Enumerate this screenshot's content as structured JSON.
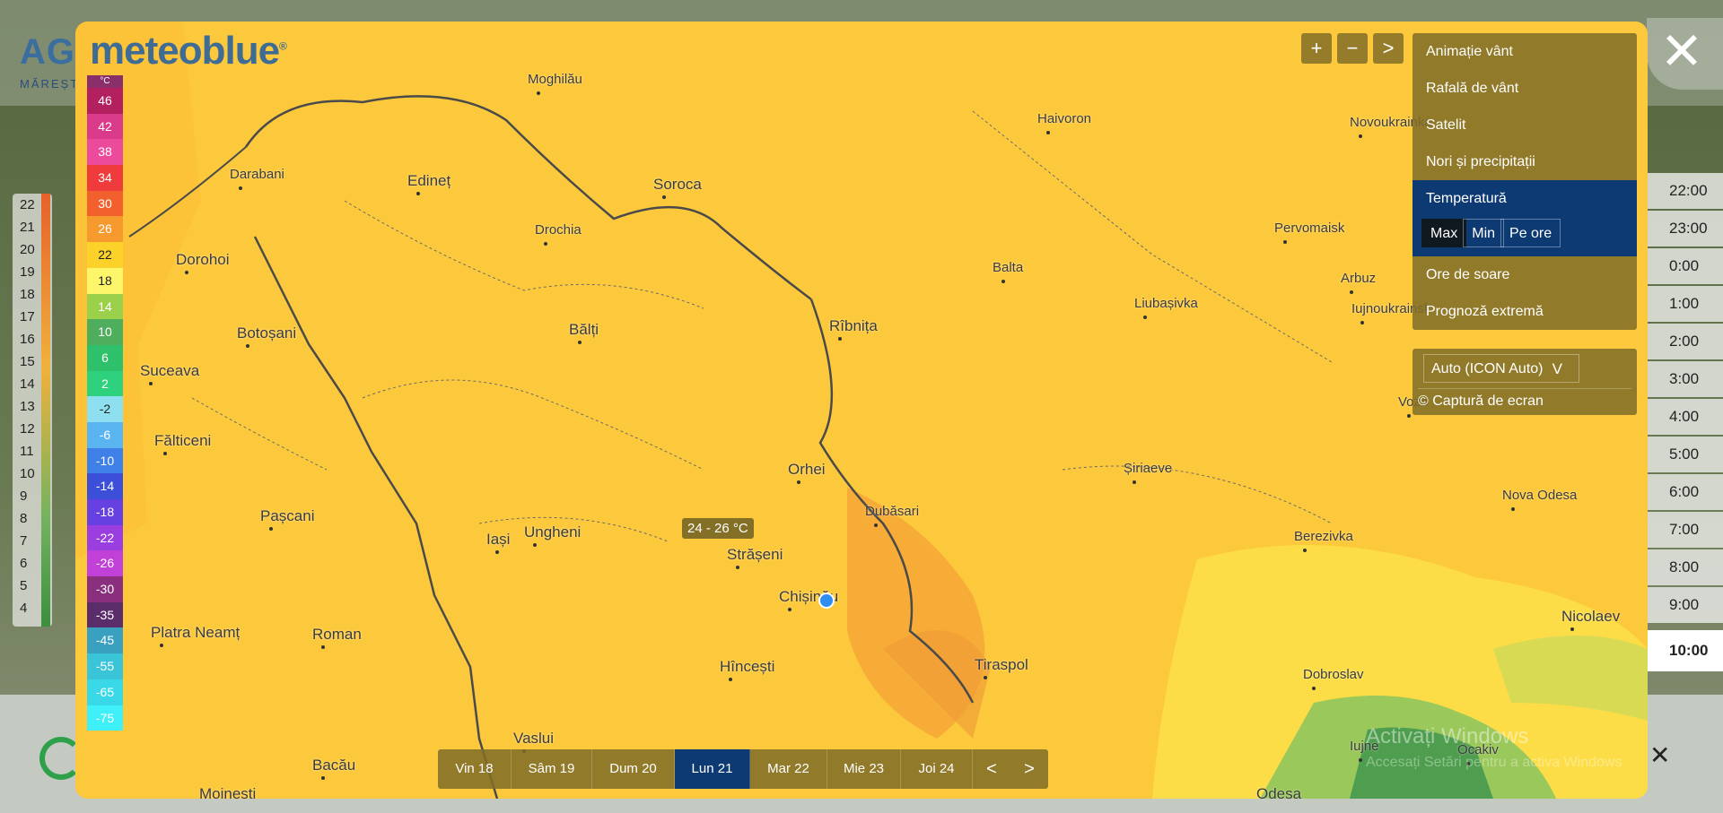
{
  "background": {
    "logo_text": "AGR",
    "logo_sub": "MĂREȘT",
    "scale_values": [
      "22",
      "21",
      "20",
      "19",
      "18",
      "17",
      "16",
      "15",
      "14",
      "13",
      "12",
      "11",
      "10",
      "9",
      "8",
      "7",
      "6",
      "5",
      "4"
    ],
    "hours": [
      "22:00",
      "23:00",
      "0:00",
      "1:00",
      "2:00",
      "3:00",
      "4:00",
      "5:00",
      "6:00",
      "7:00",
      "8:00",
      "9:00",
      "10:00"
    ],
    "selected_hour": "10:00",
    "close_big": "✕",
    "close_small": "✕"
  },
  "modal": {
    "brand": "meteoblue",
    "brand_mark": "®",
    "legend": [
      {
        "v": "46",
        "c": "#b3205f"
      },
      {
        "v": "42",
        "c": "#d93a8a"
      },
      {
        "v": "38",
        "c": "#ec4b9c"
      },
      {
        "v": "34",
        "c": "#ef3b3b"
      },
      {
        "v": "30",
        "c": "#f2612d"
      },
      {
        "v": "26",
        "c": "#f79a2e"
      },
      {
        "v": "22",
        "c": "#fbd12a"
      },
      {
        "v": "18",
        "c": "#fdf56a"
      },
      {
        "v": "14",
        "c": "#9bd04a"
      },
      {
        "v": "10",
        "c": "#4eae5e"
      },
      {
        "v": "6",
        "c": "#2fc06b"
      },
      {
        "v": "2",
        "c": "#2ed17e"
      },
      {
        "v": "-2",
        "c": "#8ee0f0"
      },
      {
        "v": "-6",
        "c": "#5ab4f0"
      },
      {
        "v": "-10",
        "c": "#3e7fe8"
      },
      {
        "v": "-14",
        "c": "#3c4fd8"
      },
      {
        "v": "-18",
        "c": "#6640e0"
      },
      {
        "v": "-22",
        "c": "#9a3ee0"
      },
      {
        "v": "-26",
        "c": "#c040d8"
      },
      {
        "v": "-30",
        "c": "#8a2f7d"
      },
      {
        "v": "-35",
        "c": "#5a2d6a"
      },
      {
        "v": "-45",
        "c": "#3aa0c0"
      },
      {
        "v": "-55",
        "c": "#3ac4d8"
      },
      {
        "v": "-65",
        "c": "#38d8e8"
      },
      {
        "v": "-75",
        "c": "#40f0f8"
      }
    ],
    "legend_top_label": "°C",
    "tooltip": "24 - 26 °C",
    "zoom_in": "+",
    "zoom_out": "−",
    "zoom_next": ">",
    "menu": {
      "items": [
        "Animație vânt",
        "Rafală de vânt",
        "Satelit",
        "Nori și precipitații",
        "Temperatură",
        "Ore de soare",
        "Prognoză extremă"
      ],
      "active": "Temperatură",
      "segments": [
        "Max",
        "Min",
        "Pe ore"
      ],
      "active_segment": "Max"
    },
    "model_select": "Auto (ICON Auto)",
    "screenshot": "© Captură de ecran",
    "days": [
      "Vin 18",
      "Sâm 19",
      "Dum 20",
      "Lun 21",
      "Mar 22",
      "Mie 23",
      "Joi 24"
    ],
    "active_day": "Lun 21",
    "prev": "<",
    "next": ">",
    "places": [
      {
        "n": "Moghilău"
      },
      {
        "n": "Edineț",
        "big": true
      },
      {
        "n": "Soroca",
        "big": true
      },
      {
        "n": "Darabani"
      },
      {
        "n": "Drochia"
      },
      {
        "n": "Dorohoi",
        "big": true
      },
      {
        "n": "Botoșani",
        "big": true
      },
      {
        "n": "Bălți",
        "big": true
      },
      {
        "n": "Rîbnița",
        "big": true
      },
      {
        "n": "Suceava",
        "big": true
      },
      {
        "n": "Fălticeni",
        "big": true
      },
      {
        "n": "Orhei",
        "big": true
      },
      {
        "n": "Dubăsari"
      },
      {
        "n": "Pașcani",
        "big": true
      },
      {
        "n": "Iași",
        "big": true
      },
      {
        "n": "Ungheni",
        "big": true
      },
      {
        "n": "Strășeni",
        "big": true
      },
      {
        "n": "Chișinău",
        "big": true
      },
      {
        "n": "Platra Neamț",
        "big": true
      },
      {
        "n": "Roman",
        "big": true
      },
      {
        "n": "Hîncești",
        "big": true
      },
      {
        "n": "Tiraspol",
        "big": true
      },
      {
        "n": "Vaslui",
        "big": true
      },
      {
        "n": "Bacău",
        "big": true
      },
      {
        "n": "Moinesti",
        "big": true
      },
      {
        "n": "Haivoron"
      },
      {
        "n": "Pervomaisk"
      },
      {
        "n": "Balta"
      },
      {
        "n": "Liubașivka"
      },
      {
        "n": "Iujnoukrainsk"
      },
      {
        "n": "Arbuz"
      },
      {
        "n": "Novoukrainka"
      },
      {
        "n": "Vozn"
      },
      {
        "n": "Șiriaeve"
      },
      {
        "n": "Nova Odesa"
      },
      {
        "n": "Berezivka"
      },
      {
        "n": "Nicolaev",
        "big": true
      },
      {
        "n": "Dobroslav"
      },
      {
        "n": "Iujne"
      },
      {
        "n": "Ocakiv"
      },
      {
        "n": "Odesa",
        "big": true
      }
    ],
    "watermark": "Activați Windows",
    "watermark_sub": "Accesați Setări pentru a activa Windows"
  }
}
